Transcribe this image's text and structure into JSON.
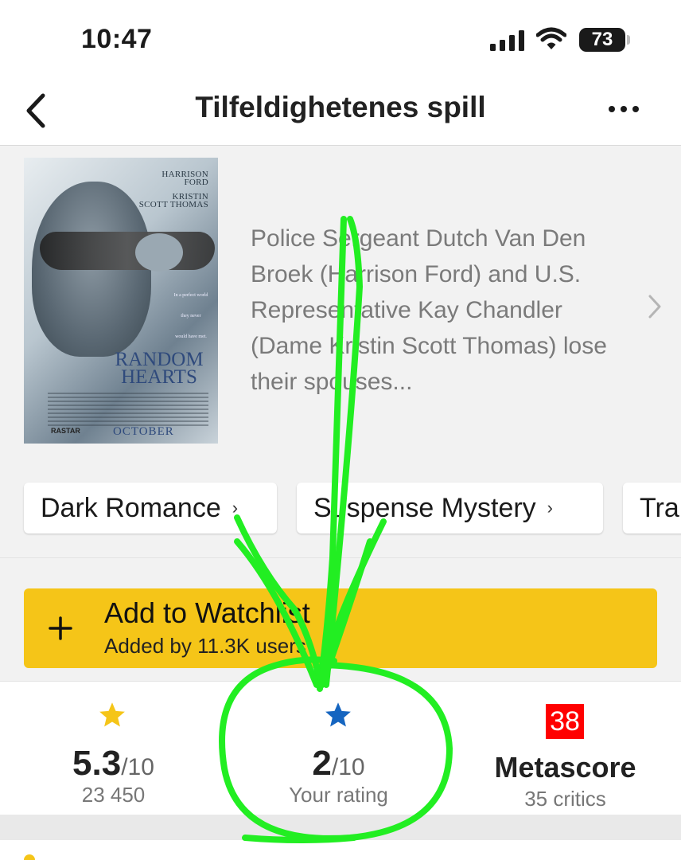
{
  "status_bar": {
    "time": "10:47",
    "battery": "73",
    "icons": [
      "signal-icon",
      "wifi-icon",
      "battery-icon"
    ]
  },
  "nav": {
    "title": "Tilfeldighetenes spill",
    "back_icon": "chevron-left-icon",
    "more_icon": "more-horizontal-icon"
  },
  "poster": {
    "actor_1_first": "HARRISON",
    "actor_1_last": "FORD",
    "actor_2_first": "KRISTIN",
    "actor_2_last": "SCOTT THOMAS",
    "tagline_1": "In a perfect world",
    "tagline_2": "they never",
    "tagline_3": "would have met.",
    "title_1": "RANDOM",
    "title_2": "HEARTS",
    "release": "OCTOBER",
    "brand": "RASTAR"
  },
  "synopsis": "Police Sergeant Dutch Van Den Broek (Harrison Ford) and U.S. Representative Kay Chandler (Dame Kristin Scott Thomas) lose their spouses...",
  "genres": [
    "Dark Romance",
    "Suspense Mystery",
    "Tra"
  ],
  "watchlist": {
    "title": "Add to Watchlist",
    "subtitle": "Added by 11.3K users"
  },
  "ratings": {
    "imdb_score": "5.3",
    "imdb_denominator": "/10",
    "imdb_votes": "23 450",
    "user_score": "2",
    "user_denominator": "/10",
    "user_label": "Your rating",
    "metascore": "38",
    "metascore_label": "Metascore",
    "critics": "35 critics"
  },
  "colors": {
    "accent_yellow": "#f5c518",
    "user_star_blue": "#1565c0",
    "metascore_red": "#ff0000",
    "annotation_green": "#22ee22"
  }
}
